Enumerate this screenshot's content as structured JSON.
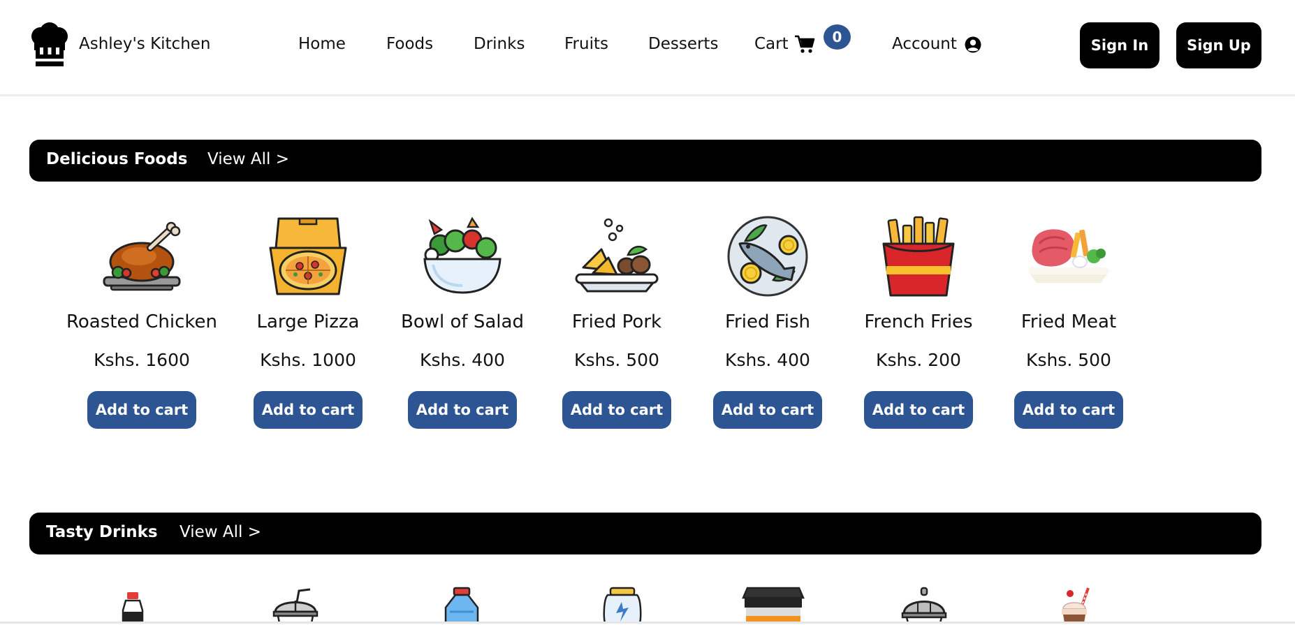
{
  "header": {
    "brand": "Ashley's Kitchen",
    "nav": [
      "Home",
      "Foods",
      "Drinks",
      "Fruits",
      "Desserts"
    ],
    "cart_label": "Cart",
    "cart_count": "0",
    "account_label": "Account",
    "signin_label": "Sign In",
    "signup_label": "Sign Up"
  },
  "foods_section": {
    "title": "Delicious Foods",
    "view_all": "View All >",
    "items": [
      {
        "name": "Roasted Chicken",
        "price": "Kshs. 1600",
        "button": "Add to cart",
        "icon": "roasted-chicken-icon"
      },
      {
        "name": "Large Pizza",
        "price": "Kshs. 1000",
        "button": "Add to cart",
        "icon": "pizza-icon"
      },
      {
        "name": "Bowl of Salad",
        "price": "Kshs. 400",
        "button": "Add to cart",
        "icon": "salad-bowl-icon"
      },
      {
        "name": "Fried Pork",
        "price": "Kshs. 500",
        "button": "Add to cart",
        "icon": "fried-pork-icon"
      },
      {
        "name": "Fried Fish",
        "price": "Kshs. 400",
        "button": "Add to cart",
        "icon": "fried-fish-icon"
      },
      {
        "name": "French Fries",
        "price": "Kshs. 200",
        "button": "Add to cart",
        "icon": "french-fries-icon"
      },
      {
        "name": "Fried Meat",
        "price": "Kshs. 500",
        "button": "Add to cart",
        "icon": "fried-meat-icon"
      }
    ]
  },
  "drinks_section": {
    "title": "Tasty Drinks",
    "view_all": "View All >",
    "icons": [
      "soda-bottle-icon",
      "cup-with-straw-icon",
      "water-bottle-icon",
      "energy-drink-icon",
      "coffee-cup-icon",
      "covered-cup-icon",
      "milkshake-icon"
    ]
  },
  "colors": {
    "accent_blue": "#2e5593",
    "bar_black": "#000000",
    "background": "#ffffff"
  }
}
